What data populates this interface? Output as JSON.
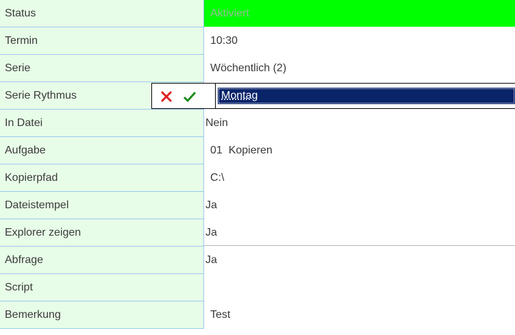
{
  "rows": [
    {
      "label": "Status",
      "value": "Aktiviert"
    },
    {
      "label": "Termin",
      "value": "10:30"
    },
    {
      "label": "Serie",
      "value": "Wöchentlich (2)"
    },
    {
      "label": "Serie Rythmus",
      "value": "Montag"
    },
    {
      "label": "In Datei",
      "value": "Nein"
    },
    {
      "label": "Aufgabe",
      "value": "01  Kopieren"
    },
    {
      "label": "Kopierpfad",
      "value": "C:\\"
    },
    {
      "label": "Dateistempel",
      "value": "Ja"
    },
    {
      "label": "Explorer zeigen",
      "value": "Ja"
    },
    {
      "label": "Abfrage",
      "value": "Ja"
    },
    {
      "label": "Script",
      "value": ""
    },
    {
      "label": "Bemerkung",
      "value": "Test"
    }
  ],
  "editor": {
    "cancel_icon": "cross-icon",
    "ok_icon": "check-icon"
  },
  "colors": {
    "label_bg": "#e8fde8",
    "grid_line": "#9ac9ee",
    "status_bg": "#00ff00",
    "selection_bg": "#0a246a",
    "cancel": "#e02020",
    "ok": "#1a8a1a"
  }
}
